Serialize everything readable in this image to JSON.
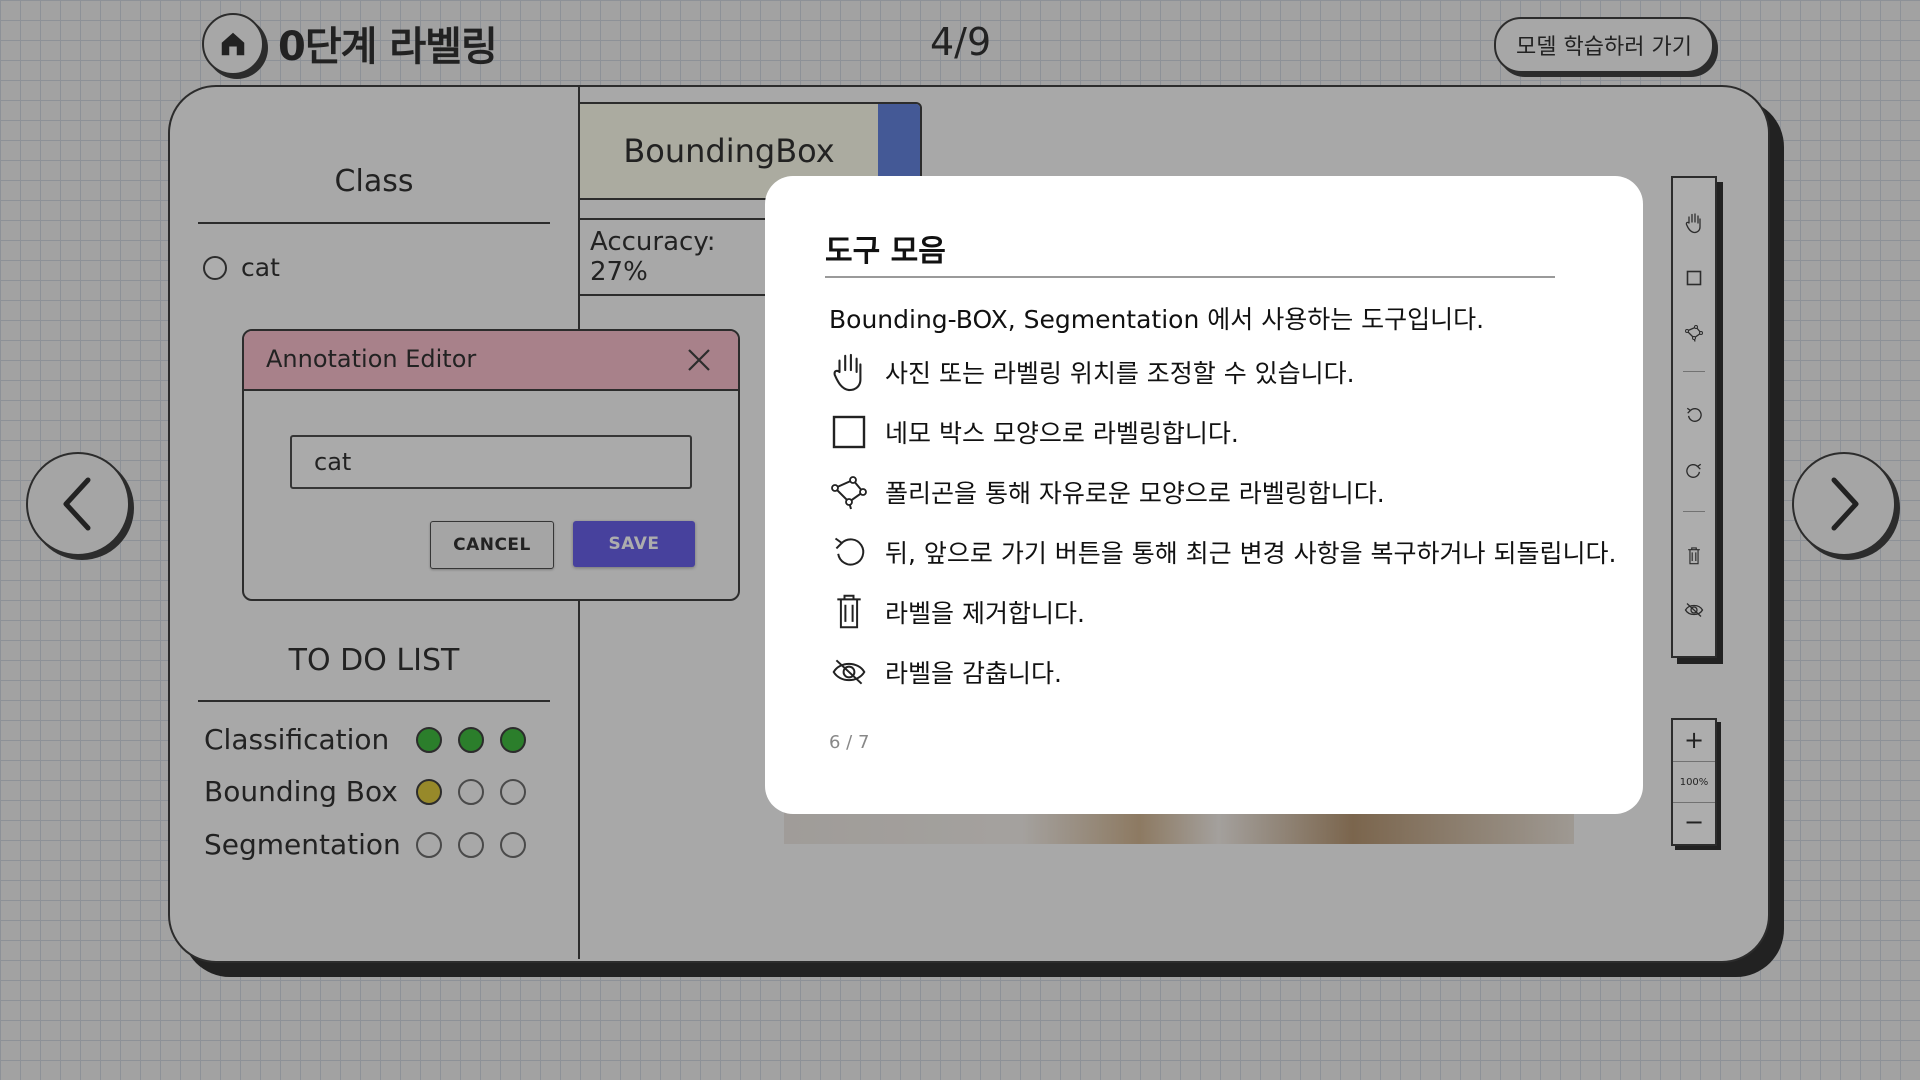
{
  "header": {
    "title": "0단계 라벨링",
    "counter": "4/9",
    "go_model_label": "모델 학습하러 가기"
  },
  "sidebar": {
    "class_title": "Class",
    "classes": [
      {
        "label": "cat"
      }
    ],
    "todo_title": "TO DO LIST",
    "todo": [
      {
        "label": "Classification",
        "states": [
          "done",
          "done",
          "done"
        ]
      },
      {
        "label": "Bounding Box",
        "states": [
          "current",
          "empty",
          "empty"
        ]
      },
      {
        "label": "Segmentation",
        "states": [
          "empty",
          "empty",
          "empty"
        ]
      }
    ]
  },
  "tab": {
    "label": "BoundingBox",
    "accuracy": "Accuracy: 27%"
  },
  "editor": {
    "title": "Annotation Editor",
    "input_value": "cat",
    "cancel_label": "CANCEL",
    "save_label": "SAVE"
  },
  "toolbar": {
    "tools": [
      "hand-icon",
      "rectangle-icon",
      "polygon-icon",
      "undo-icon",
      "redo-icon",
      "trash-icon",
      "eye-off-icon"
    ],
    "zoom_in": "+",
    "zoom_level": "100%",
    "zoom_out": "−"
  },
  "modal": {
    "title": "도구 모음",
    "intro": "Bounding-BOX, Segmentation 에서 사용하는 도구입니다.",
    "items": [
      {
        "icon": "hand-icon",
        "text": "사진 또는 라벨링 위치를 조정할 수 있습니다."
      },
      {
        "icon": "rectangle-icon",
        "text": "네모 박스 모양으로 라벨링합니다."
      },
      {
        "icon": "polygon-icon",
        "text": "폴리곤을 통해 자유로운 모양으로 라벨링합니다."
      },
      {
        "icon": "undo-icon",
        "text": "뒤, 앞으로 가기 버튼을 통해 최근 변경 사항을 복구하거나 되돌립니다."
      },
      {
        "icon": "trash-icon",
        "text": "라벨을 제거합니다."
      },
      {
        "icon": "eye-off-icon",
        "text": "라벨을 감춥니다."
      }
    ],
    "page_indicator": "6 / 7"
  },
  "colors": {
    "done": "#1fae1f",
    "current": "#d9c11e",
    "tab_accent": "#4a6fd8",
    "editor_header": "#f6b3c3",
    "save_button": "#5046e4"
  }
}
